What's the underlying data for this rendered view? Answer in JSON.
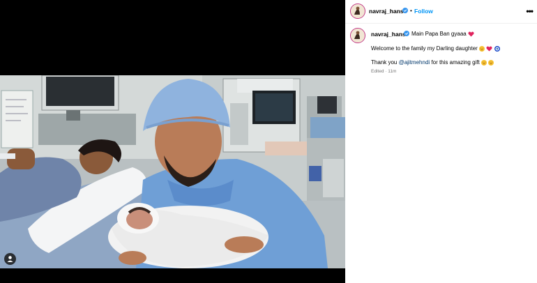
{
  "post": {
    "username": "navraj_hans",
    "follow_label": "Follow",
    "separator": "•",
    "more_label": "•••"
  },
  "caption": {
    "username": "navraj_hans",
    "headline": "Main Papa Ban gyaaa",
    "line2": "Welcome to the family my Darling daughter",
    "line3_prefix": "Thank you ",
    "mention": "@ajitmehndi",
    "line3_suffix": " for this amazing gift",
    "edited": "Edited · 11m"
  },
  "colors": {
    "accent": "#0095f6",
    "verified": "#3897f0",
    "mention": "#00376b",
    "heart": "#e0245e",
    "evil_eye": "#1a49c8"
  },
  "icons": {
    "verified": "verified-badge-icon",
    "more": "more-options-icon",
    "tags": "user-tag-icon"
  }
}
